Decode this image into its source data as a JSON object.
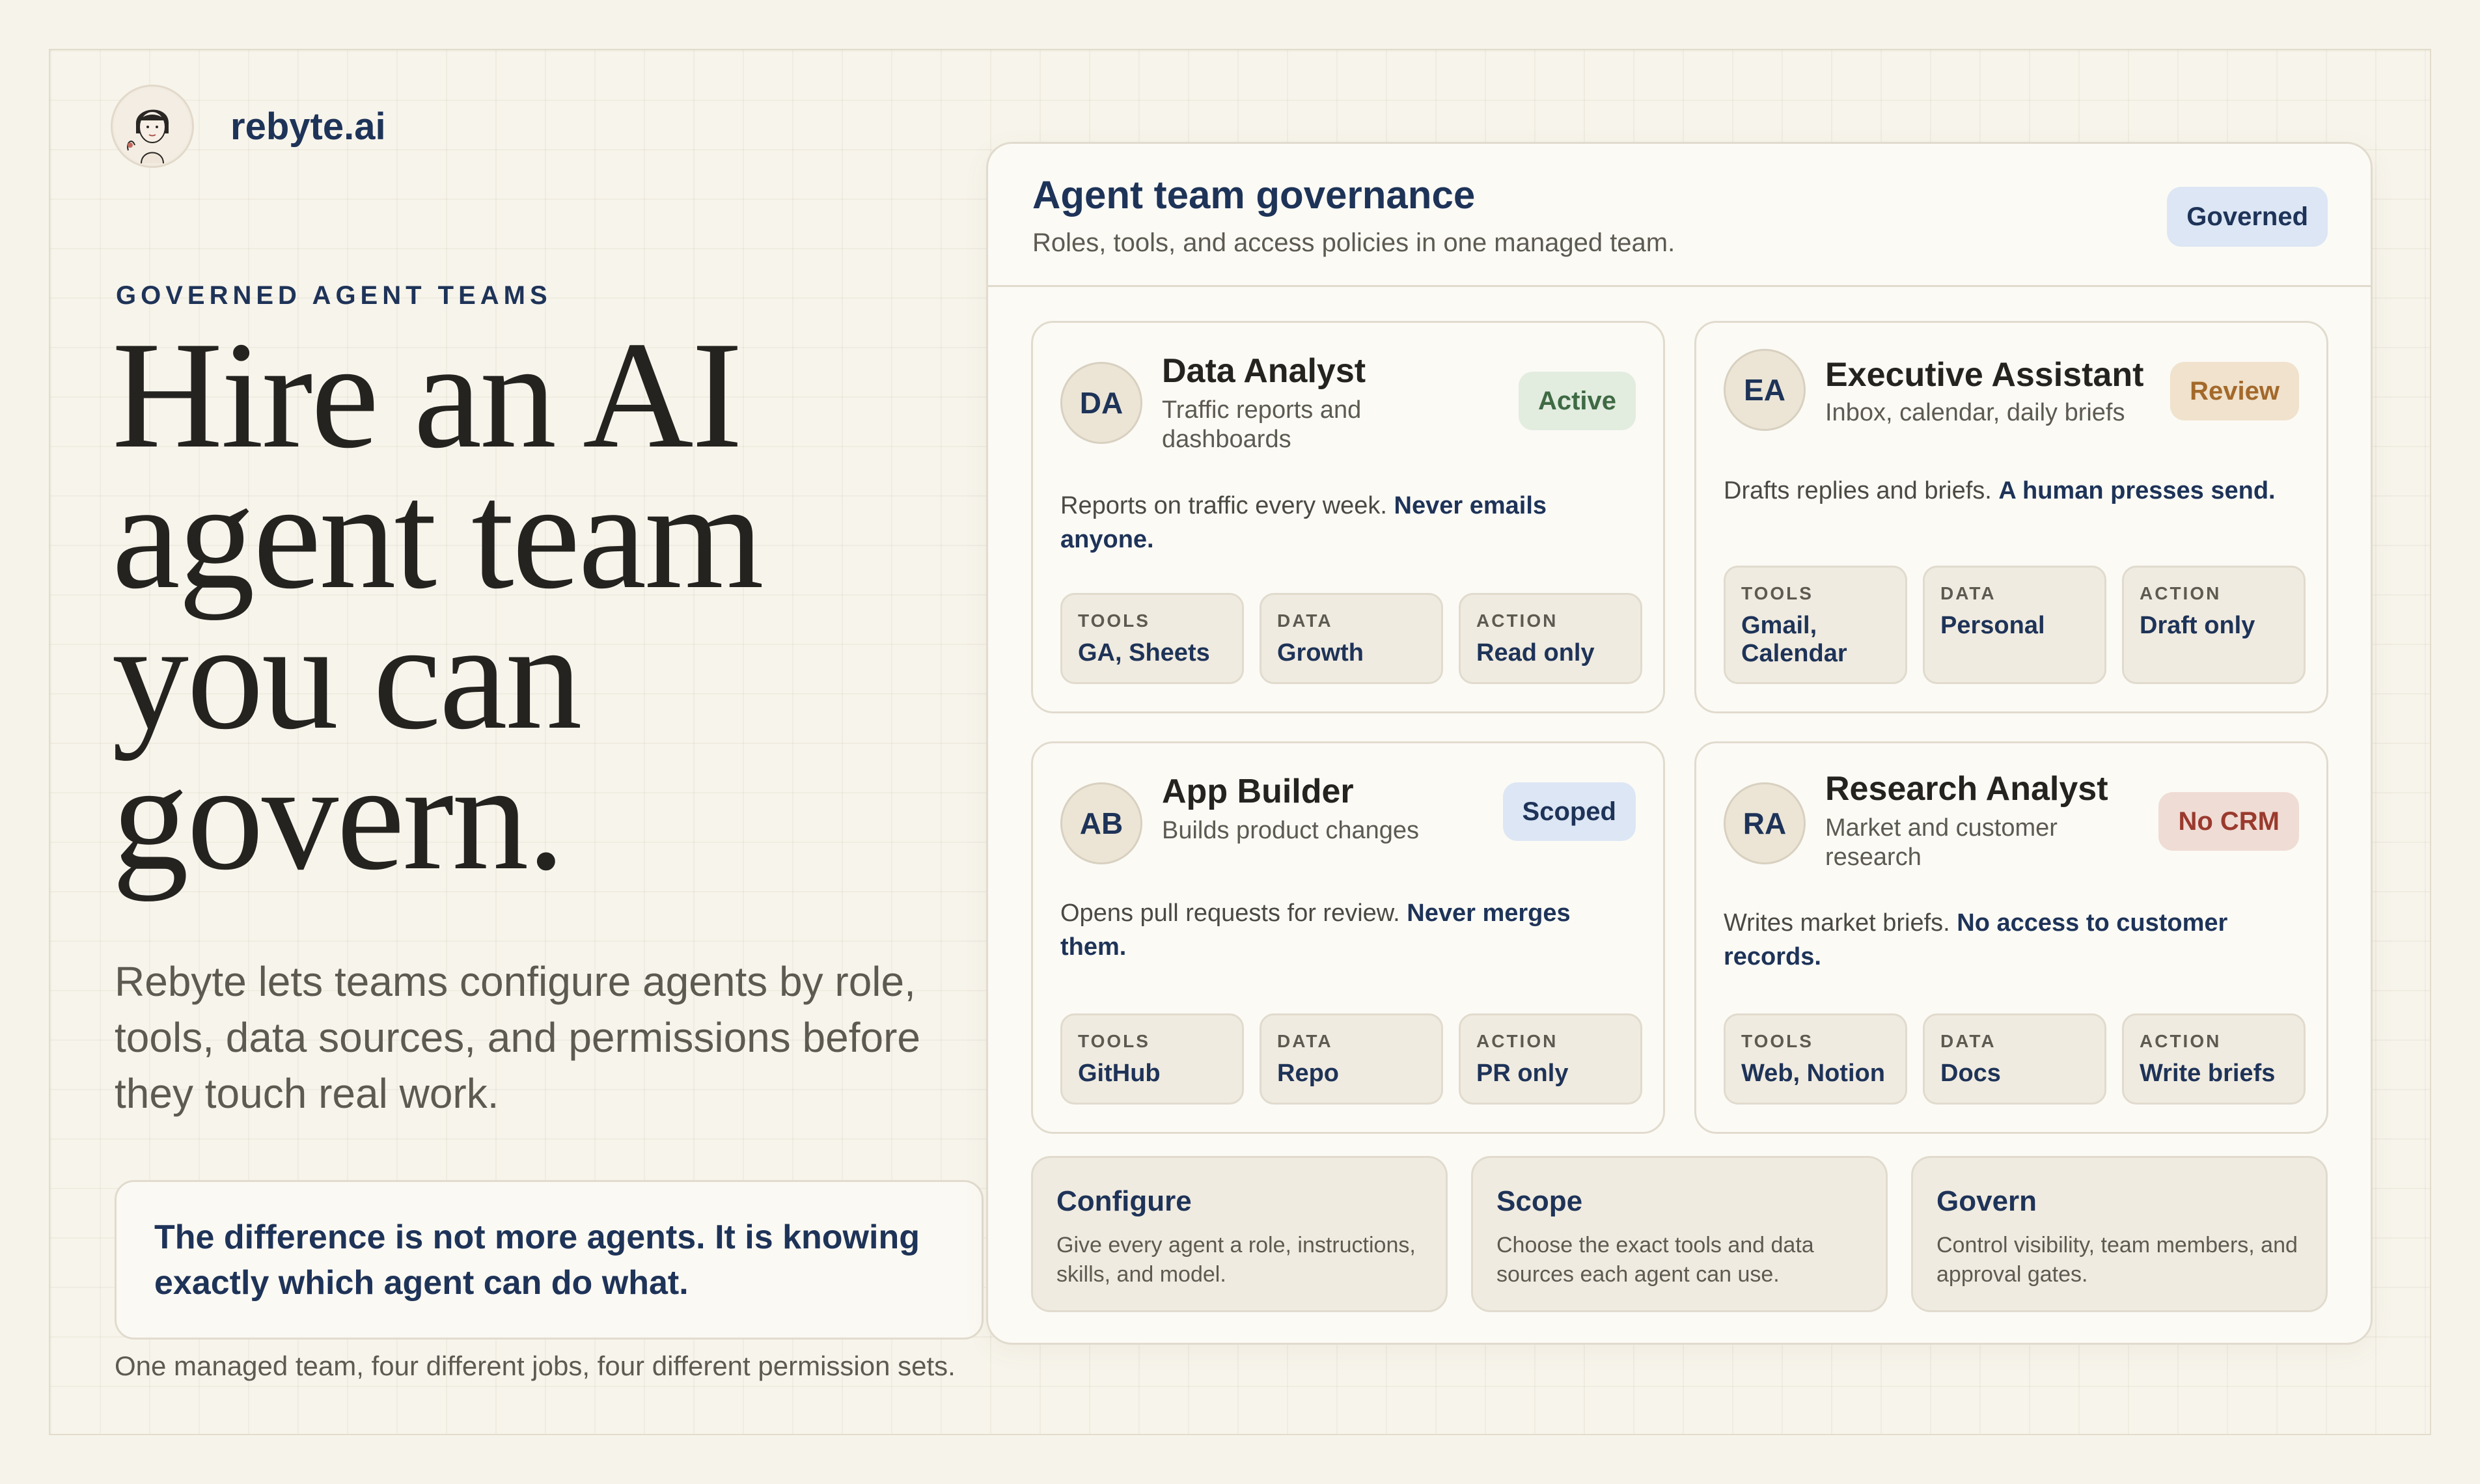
{
  "brand": {
    "name": "rebyte.ai"
  },
  "hero": {
    "eyebrow": "GOVERNED AGENT TEAMS",
    "headline": "Hire an AI agent team you can govern.",
    "lede": "Rebyte lets teams configure agents by role, tools, data sources, and permissions before they touch real work.",
    "callout": "The difference is not more agents. It is knowing exactly which agent can do what.",
    "footnote": "One managed team, four different jobs, four different permission sets."
  },
  "panel": {
    "title": "Agent team governance",
    "subtitle": "Roles, tools, and access policies in one managed team.",
    "badge": "Governed",
    "agents": [
      {
        "initials": "DA",
        "name": "Data Analyst",
        "description": "Traffic reports and dashboards",
        "status": "Active",
        "body_plain": "Reports on traffic every week. ",
        "body_strong": "Never emails anyone.",
        "chips": [
          {
            "key": "TOOLS",
            "value": "GA, Sheets"
          },
          {
            "key": "DATA",
            "value": "Growth"
          },
          {
            "key": "ACTION",
            "value": "Read only"
          }
        ]
      },
      {
        "initials": "EA",
        "name": "Executive Assistant",
        "description": "Inbox, calendar, daily briefs",
        "status": "Review",
        "body_plain": "Drafts replies and briefs. ",
        "body_strong": "A human presses send.",
        "chips": [
          {
            "key": "TOOLS",
            "value": "Gmail, Calendar"
          },
          {
            "key": "DATA",
            "value": "Personal"
          },
          {
            "key": "ACTION",
            "value": "Draft only"
          }
        ]
      },
      {
        "initials": "AB",
        "name": "App Builder",
        "description": "Builds product changes",
        "status": "Scoped",
        "body_plain": "Opens pull requests for review. ",
        "body_strong": "Never merges them.",
        "chips": [
          {
            "key": "TOOLS",
            "value": "GitHub"
          },
          {
            "key": "DATA",
            "value": "Repo"
          },
          {
            "key": "ACTION",
            "value": "PR only"
          }
        ]
      },
      {
        "initials": "RA",
        "name": "Research Analyst",
        "description": "Market and customer research",
        "status": "No CRM",
        "body_plain": "Writes market briefs. ",
        "body_strong": "No access to customer records.",
        "chips": [
          {
            "key": "TOOLS",
            "value": "Web, Notion"
          },
          {
            "key": "DATA",
            "value": "Docs"
          },
          {
            "key": "ACTION",
            "value": "Write briefs"
          }
        ]
      }
    ],
    "steps": [
      {
        "title": "Configure",
        "text": "Give every agent a role, instructions, skills, and model."
      },
      {
        "title": "Scope",
        "text": "Choose the exact tools and data sources each agent can use."
      },
      {
        "title": "Govern",
        "text": "Control visibility, team members, and approval gates."
      }
    ]
  }
}
